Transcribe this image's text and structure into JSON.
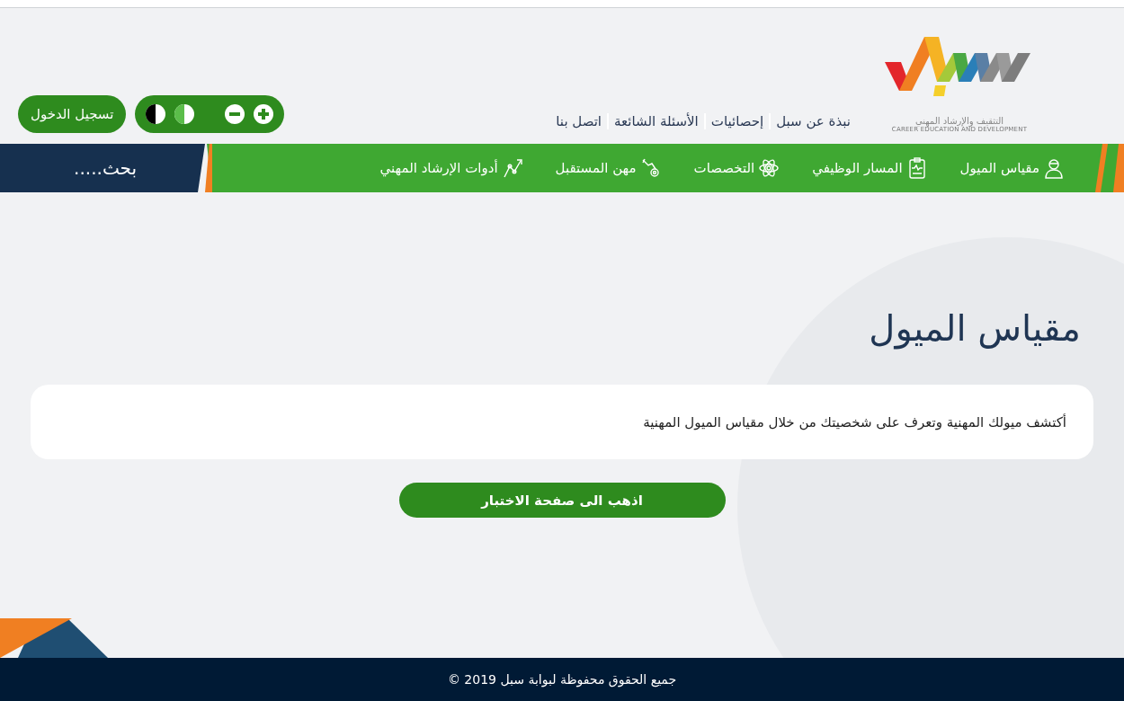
{
  "logo": {
    "arabic": "التثقيف والإرشاد المهني",
    "english": "CAREER EDUCATION AND DEVELOPMENT"
  },
  "top_links": [
    "نبذة عن سبل",
    "إحصائيات",
    "الأسئلة الشائعة",
    "اتصل بنا"
  ],
  "login_button": "تسجيل الدخول",
  "nav_items": [
    {
      "label": "مقياس الميول"
    },
    {
      "label": "المسار الوظيفي"
    },
    {
      "label": "التخصصات"
    },
    {
      "label": "مهن المستقبل"
    },
    {
      "label": "أدوات الإرشاد المهني"
    }
  ],
  "search": {
    "placeholder": "بحث....."
  },
  "page_title": "مقياس الميول",
  "intro_text": "أكتشف ميولك المهنية وتعرف على شخصيتك من خلال مقياس الميول المهنية",
  "test_button": "اذهب الى صفحة الاختبار",
  "footer": "جميع الحقوق محفوظة لبوابة سبل 2019 ©"
}
